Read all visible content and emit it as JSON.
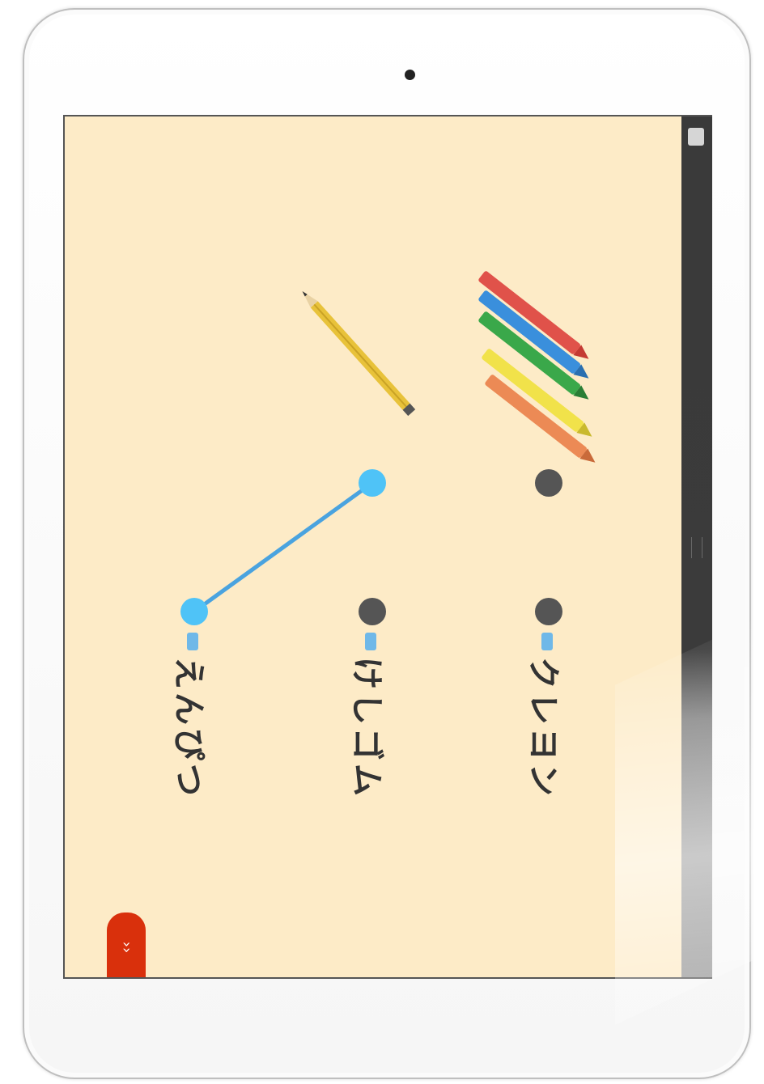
{
  "app": {
    "labels": {
      "crayon": "クレヨン",
      "eraser": "けしゴム",
      "pencil": "えんぴつ"
    },
    "next_button": "››",
    "connected_pair": [
      "pencil-image-dot",
      "pencil-word-dot"
    ],
    "colors": {
      "screen_bg": "#fdebc7",
      "dot_inactive": "#555555",
      "dot_active": "#4fc3f7",
      "line_active": "#4aa3df",
      "next_button": "#d9300c"
    }
  }
}
